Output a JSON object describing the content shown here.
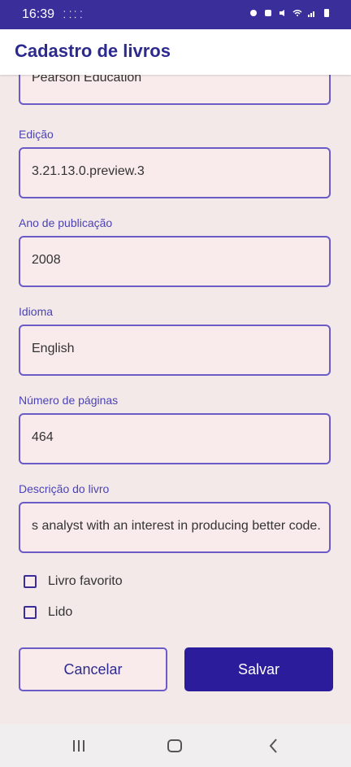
{
  "status_bar": {
    "time": "16:39",
    "mini_icons": "⸬ ⸬"
  },
  "app_bar": {
    "title": "Cadastro de livros"
  },
  "form": {
    "publisher_value": "Pearson Education",
    "edition_label": "Edição",
    "edition_value": "3.21.13.0.preview.3",
    "year_label": "Ano de publicação",
    "year_value": "2008",
    "language_label": "Idioma",
    "language_value": "English",
    "pages_label": "Número de páginas",
    "pages_value": "464",
    "description_label": "Descrição do livro",
    "description_value": "s analyst with an interest in producing better code."
  },
  "checkboxes": {
    "favorite_label": "Livro favorito",
    "read_label": "Lido"
  },
  "buttons": {
    "cancel_label": "Cancelar",
    "save_label": "Salvar"
  },
  "colors": {
    "primary": "#2b1c9c",
    "outline": "#6b5bc7",
    "background": "#f3e9e8"
  }
}
